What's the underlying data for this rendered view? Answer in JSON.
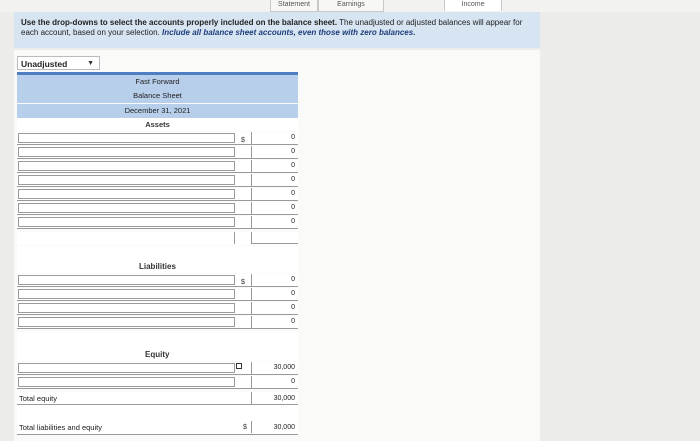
{
  "tabs": {
    "statement": "Statement",
    "earnings": "Earnings",
    "income": "Income"
  },
  "instructions": {
    "text": "Use the drop-downs to select the accounts properly included on the balance sheet.",
    "text2": "The unadjusted or adjusted balances will appear for each account, based on your selection.",
    "emphasis": "Include all balance sheet accounts, even those with zero balances."
  },
  "selector": {
    "selected": "Unadjusted"
  },
  "sheet": {
    "company": "Fast Forward",
    "title": "Balance Sheet",
    "date": "December 31, 2021",
    "assets_label": "Assets",
    "liabilities_label": "Liabilities",
    "equity_label": "Equity",
    "currency": "$",
    "asset_values": [
      "0",
      "0",
      "0",
      "0",
      "0",
      "0",
      "0"
    ],
    "liability_values": [
      "0",
      "0",
      "0",
      "0"
    ],
    "equity_values": [
      "30,000",
      "0"
    ],
    "total_equity_label": "Total equity",
    "total_equity_value": "30,000",
    "total_le_label": "Total liabilities and equity",
    "total_le_value": "30,000"
  }
}
